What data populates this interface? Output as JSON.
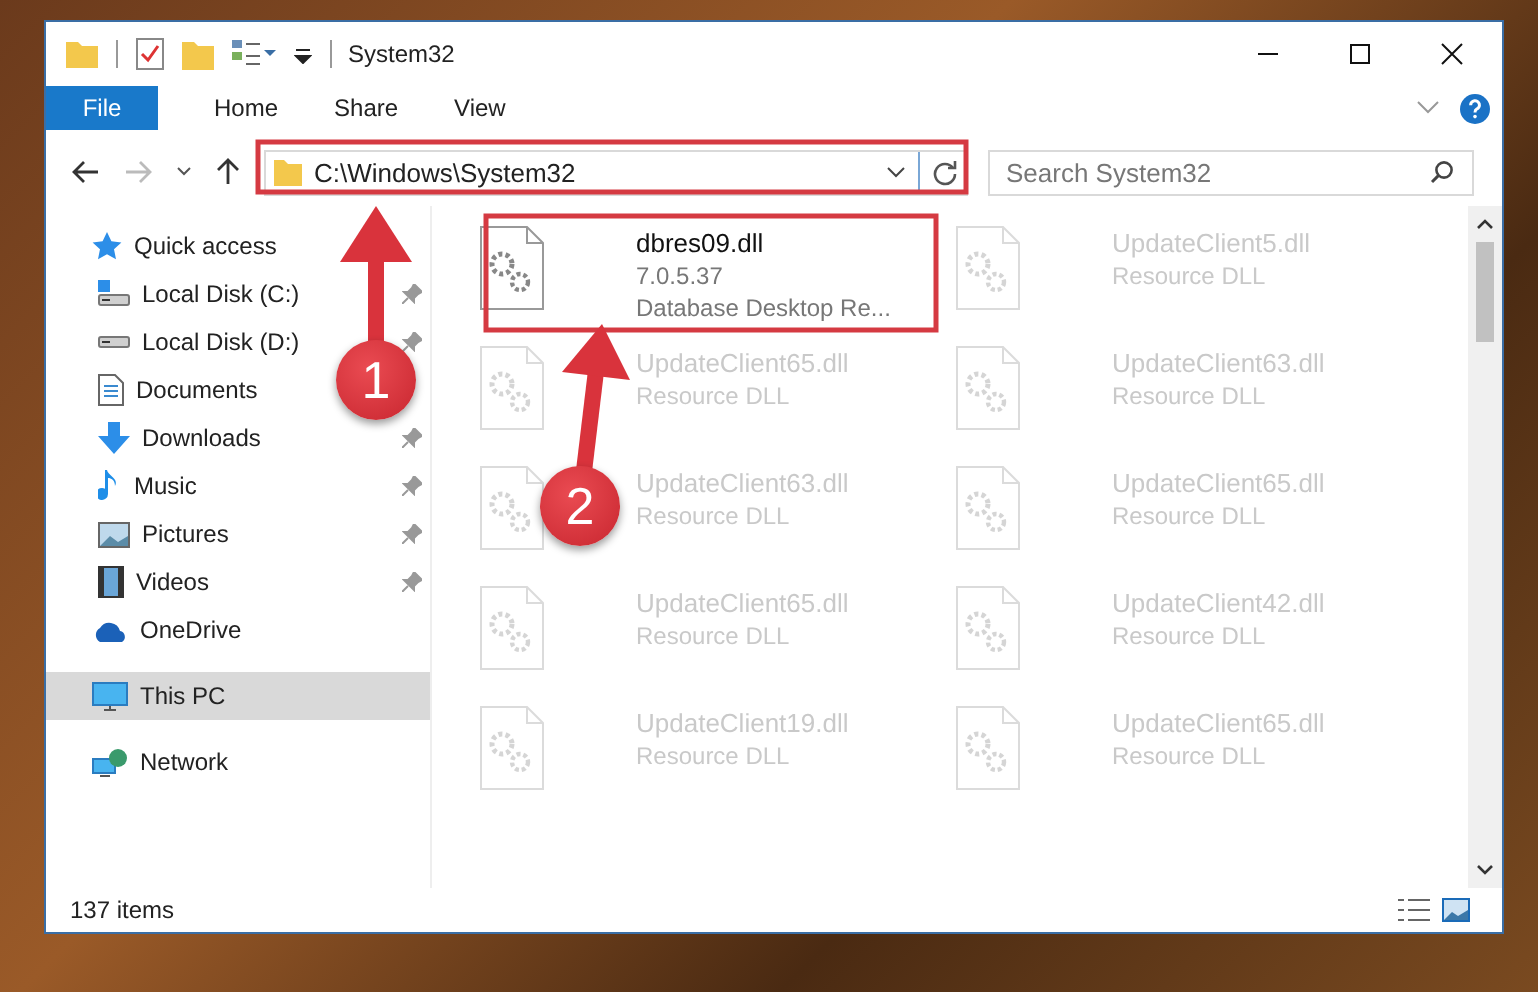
{
  "window": {
    "title": "System32"
  },
  "ribbon": {
    "tabs": [
      {
        "label": "File",
        "kind": "menu"
      },
      {
        "label": "Home",
        "kind": "tab"
      },
      {
        "label": "Share",
        "kind": "tab"
      },
      {
        "label": "View",
        "kind": "tab"
      }
    ]
  },
  "address_bar": {
    "path": "C:\\Windows\\System32"
  },
  "search": {
    "placeholder": "Search System32"
  },
  "nav_pane": {
    "items": [
      {
        "label": "Quick access",
        "kind": "star",
        "selected": false,
        "children": [
          {
            "label": "Local Disk (C:)",
            "kind": "drive-c",
            "pinned": true
          },
          {
            "label": "Local Disk (D:)",
            "kind": "drive",
            "pinned": true
          },
          {
            "label": "Documents",
            "kind": "document",
            "pinned": false
          },
          {
            "label": "Downloads",
            "kind": "download",
            "pinned": true
          },
          {
            "label": "Music",
            "kind": "music",
            "pinned": true
          },
          {
            "label": "Pictures",
            "kind": "picture",
            "pinned": true
          },
          {
            "label": "Videos",
            "kind": "video",
            "pinned": true
          }
        ]
      },
      {
        "label": "OneDrive",
        "kind": "cloud",
        "selected": false
      },
      {
        "label": "This PC",
        "kind": "pc",
        "selected": true
      },
      {
        "label": "Network",
        "kind": "network",
        "selected": false
      }
    ]
  },
  "files": [
    {
      "name": "dbres09.dll",
      "details": [
        "7.0.5.37",
        "Database Desktop Re..."
      ],
      "dimmed": false
    },
    {
      "name": "UpdateClient5.dll",
      "details": [
        "Resource DLL"
      ],
      "dimmed": true
    },
    {
      "name": "UpdateClient65.dll",
      "details": [
        "Resource DLL"
      ],
      "dimmed": true
    },
    {
      "name": "UpdateClient63.dll",
      "details": [
        "Resource DLL"
      ],
      "dimmed": true
    },
    {
      "name": "UpdateClient63.dll",
      "details": [
        "Resource DLL"
      ],
      "dimmed": true
    },
    {
      "name": "UpdateClient65.dll",
      "details": [
        "Resource DLL"
      ],
      "dimmed": true
    },
    {
      "name": "UpdateClient65.dll",
      "details": [
        "Resource DLL"
      ],
      "dimmed": true
    },
    {
      "name": "UpdateClient42.dll",
      "details": [
        "Resource DLL"
      ],
      "dimmed": true
    },
    {
      "name": "UpdateClient19.dll",
      "details": [
        "Resource DLL"
      ],
      "dimmed": true
    },
    {
      "name": "UpdateClient65.dll",
      "details": [
        "Resource DLL"
      ],
      "dimmed": true
    }
  ],
  "status_bar": {
    "item_count": "137 items"
  },
  "annotations": [
    {
      "label": "1"
    },
    {
      "label": "2"
    }
  ]
}
